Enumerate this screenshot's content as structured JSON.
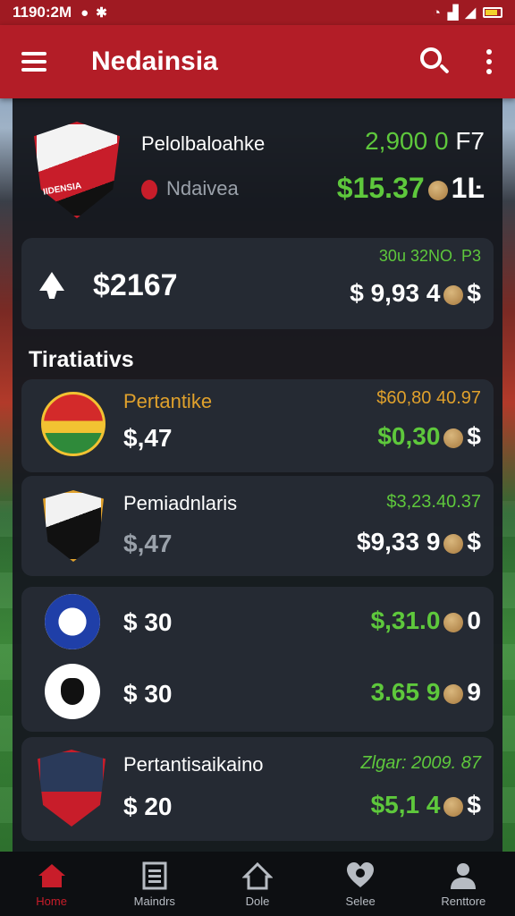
{
  "status": {
    "time": "1190:2M",
    "icons": [
      "message-icon",
      "settings-icon",
      "alarm-icon",
      "signal-icon",
      "wifi-icon",
      "battery-icon"
    ]
  },
  "appbar": {
    "title": "Nedainsia"
  },
  "feature": {
    "badge_text": "IIDENSIA",
    "name": "Pelolbaloahke",
    "sub": "Ndaivea",
    "value1": "2,900 0",
    "value1_unit": "F7",
    "value2": "$15.37",
    "value2_tail": "1Ŀ"
  },
  "summary": {
    "amount": "$2167",
    "top": "30u 32NO. P3",
    "value": "$ 9,93 4",
    "value_tail": "$"
  },
  "section": {
    "title": "Tiratiativs"
  },
  "rows": [
    {
      "name": "Pertantike",
      "price": "$,47",
      "top": "$60,80 40.97",
      "value": "$0,30",
      "tail": "$"
    },
    {
      "name": "Pemiadnlaris",
      "price": "$,47",
      "top": "$3,23.40.37",
      "value": "$9,33 9",
      "tail": "$"
    },
    {
      "price": "$ 30",
      "value": "$,31.0",
      "tail": "0"
    },
    {
      "price": "$ 30",
      "value": "3.65 9",
      "tail": "9"
    },
    {
      "name": "Pertantisaikaino",
      "price": "$ 20",
      "top": "Zlgar: 2009. 87",
      "value": "$5,1 4",
      "tail": "$"
    }
  ],
  "bottom_nav": [
    {
      "label": "Home",
      "icon": "home-icon"
    },
    {
      "label": "Maindrs",
      "icon": "list-icon"
    },
    {
      "label": "Dole",
      "icon": "house-outline-icon"
    },
    {
      "label": "Selee",
      "icon": "heart-icon"
    },
    {
      "label": "Renttore",
      "icon": "person-icon"
    }
  ],
  "colors": {
    "primary": "#b31d27",
    "accent_green": "#5ec83c",
    "accent_orange": "#e0a12c",
    "panel": "#252a33"
  }
}
